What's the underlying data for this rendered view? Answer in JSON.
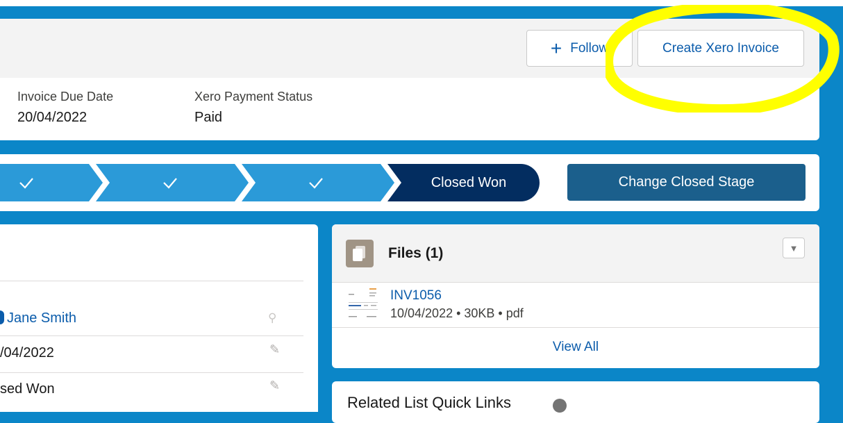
{
  "header": {
    "follow_label": "Follow",
    "create_invoice_label": "Create Xero Invoice",
    "fields": [
      {
        "label": "Invoice Due Date",
        "value": "20/04/2022"
      },
      {
        "label": "Xero Payment Status",
        "value": "Paid"
      }
    ]
  },
  "path": {
    "completed_steps": 3,
    "current_stage": "Closed Won",
    "change_button": "Change Closed Stage",
    "colors": {
      "completed": "#2b9ad8",
      "current": "#032d60"
    }
  },
  "details": {
    "rows": [
      {
        "value": "Jane Smith",
        "icon": "change-owner-icon"
      },
      {
        "value": "/04/2022",
        "icon": "pencil-icon"
      },
      {
        "value": "sed Won",
        "icon": "pencil-icon"
      }
    ]
  },
  "files": {
    "title": "Files (1)",
    "items": [
      {
        "name": "INV1056",
        "meta": "10/04/2022 • 30KB • pdf"
      }
    ],
    "view_all": "View All"
  },
  "quick_links": {
    "title": "Related List Quick Links"
  },
  "annotation": {
    "color": "#ffff00",
    "shape": "ellipse"
  }
}
